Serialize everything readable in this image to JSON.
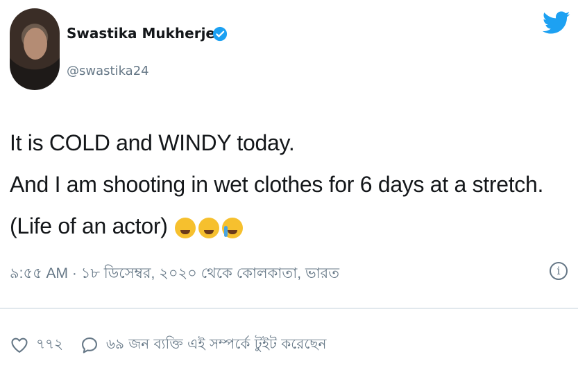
{
  "author": {
    "name": "Swastika Mukherjee",
    "handle": "@swastika24",
    "verified": true
  },
  "tweet": {
    "lines": [
      "It is COLD and WINDY today.",
      "And I am shooting in wet clothes for 6 days at a stretch.",
      "(Life of an actor)"
    ],
    "emojis": [
      "crying-face-emoji",
      "weary-face-emoji",
      "loudly-crying-face-emoji"
    ]
  },
  "meta": {
    "timestamp_line": "৯:৫৫ AM · ১৮ ডিসেম্বর, ২০২০ থেকে কোলকাতা, ভারত"
  },
  "actions": {
    "like_count": "৭৭২",
    "reply_text": "৬৯ জন ব্যক্তি এই সম্পর্কে টুইট করেছেন"
  },
  "colors": {
    "twitter_blue": "#1da1f2",
    "secondary_text": "#657786"
  }
}
